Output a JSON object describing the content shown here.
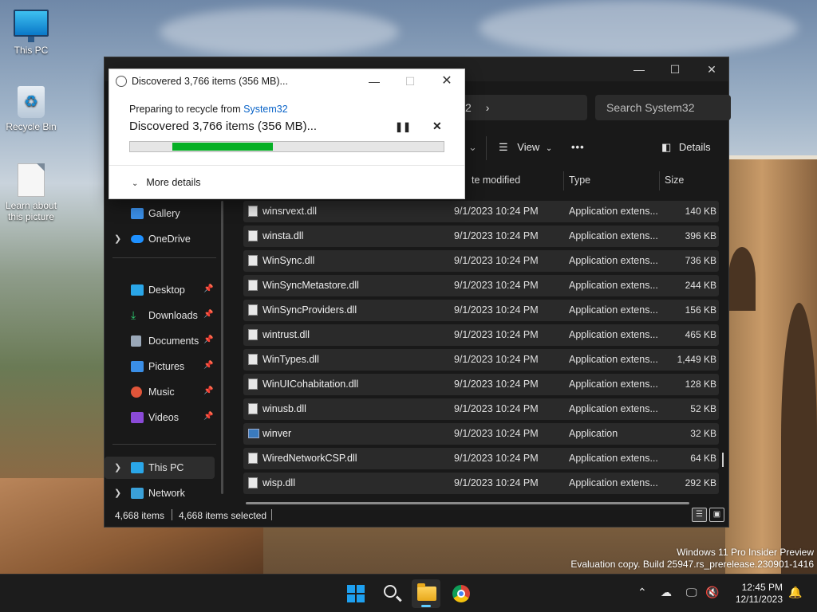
{
  "desktop": {
    "icons": [
      {
        "label": "This PC"
      },
      {
        "label": "Recycle Bin"
      },
      {
        "label": "Learn about this picture"
      }
    ],
    "watermark": {
      "line1": "Windows 11 Pro Insider Preview",
      "line2": "Evaluation copy. Build 25947.rs_prerelease.230901-1416"
    }
  },
  "explorer": {
    "address_fragment": "2",
    "address_chevron": "›",
    "search_placeholder": "Search System32",
    "toolbar": {
      "view_label": "View",
      "more_label": "•••",
      "details_label": "Details"
    },
    "columns": {
      "date": "te modified",
      "type": "Type",
      "size": "Size"
    },
    "nav": [
      {
        "label": "Gallery",
        "expand": false,
        "pinned": false
      },
      {
        "label": "OneDrive",
        "expand": true,
        "pinned": false
      },
      {
        "label": "Desktop",
        "expand": false,
        "pinned": true
      },
      {
        "label": "Downloads",
        "expand": false,
        "pinned": true
      },
      {
        "label": "Documents",
        "expand": false,
        "pinned": true
      },
      {
        "label": "Pictures",
        "expand": false,
        "pinned": true
      },
      {
        "label": "Music",
        "expand": false,
        "pinned": true
      },
      {
        "label": "Videos",
        "expand": false,
        "pinned": true
      },
      {
        "label": "This PC",
        "expand": true,
        "pinned": false
      },
      {
        "label": "Network",
        "expand": true,
        "pinned": false
      }
    ],
    "files": [
      {
        "name": "winsrvext.dll",
        "date": "9/1/2023 10:24 PM",
        "type": "Application extens...",
        "size": "140 KB",
        "kind": "dll"
      },
      {
        "name": "winsta.dll",
        "date": "9/1/2023 10:24 PM",
        "type": "Application extens...",
        "size": "396 KB",
        "kind": "dll"
      },
      {
        "name": "WinSync.dll",
        "date": "9/1/2023 10:24 PM",
        "type": "Application extens...",
        "size": "736 KB",
        "kind": "dll"
      },
      {
        "name": "WinSyncMetastore.dll",
        "date": "9/1/2023 10:24 PM",
        "type": "Application extens...",
        "size": "244 KB",
        "kind": "dll"
      },
      {
        "name": "WinSyncProviders.dll",
        "date": "9/1/2023 10:24 PM",
        "type": "Application extens...",
        "size": "156 KB",
        "kind": "dll"
      },
      {
        "name": "wintrust.dll",
        "date": "9/1/2023 10:24 PM",
        "type": "Application extens...",
        "size": "465 KB",
        "kind": "dll"
      },
      {
        "name": "WinTypes.dll",
        "date": "9/1/2023 10:24 PM",
        "type": "Application extens...",
        "size": "1,449 KB",
        "kind": "dll"
      },
      {
        "name": "WinUICohabitation.dll",
        "date": "9/1/2023 10:24 PM",
        "type": "Application extens...",
        "size": "128 KB",
        "kind": "dll"
      },
      {
        "name": "winusb.dll",
        "date": "9/1/2023 10:24 PM",
        "type": "Application extens...",
        "size": "52 KB",
        "kind": "dll"
      },
      {
        "name": "winver",
        "date": "9/1/2023 10:24 PM",
        "type": "Application",
        "size": "32 KB",
        "kind": "app"
      },
      {
        "name": "WiredNetworkCSP.dll",
        "date": "9/1/2023 10:24 PM",
        "type": "Application extens...",
        "size": "64 KB",
        "kind": "dll"
      },
      {
        "name": "wisp.dll",
        "date": "9/1/2023 10:24 PM",
        "type": "Application extens...",
        "size": "292 KB",
        "kind": "dll"
      }
    ],
    "status": {
      "items": "4,668 items",
      "selected": "4,668 items selected"
    }
  },
  "dialog": {
    "title": "Discovered 3,766 items (356 MB)...",
    "from_prefix": "Preparing to recycle from ",
    "from_link": "System32",
    "status": "Discovered 3,766 items (356 MB)...",
    "progress": {
      "start": 0.135,
      "end": 0.455
    },
    "more_details": "More details",
    "progress_color": "#06b025"
  },
  "taskbar": {
    "time": "12:45 PM",
    "date": "12/11/2023"
  },
  "colors": {
    "explorer_bg": "#191919",
    "accent": "#60cdff",
    "link": "#0a64c8"
  }
}
